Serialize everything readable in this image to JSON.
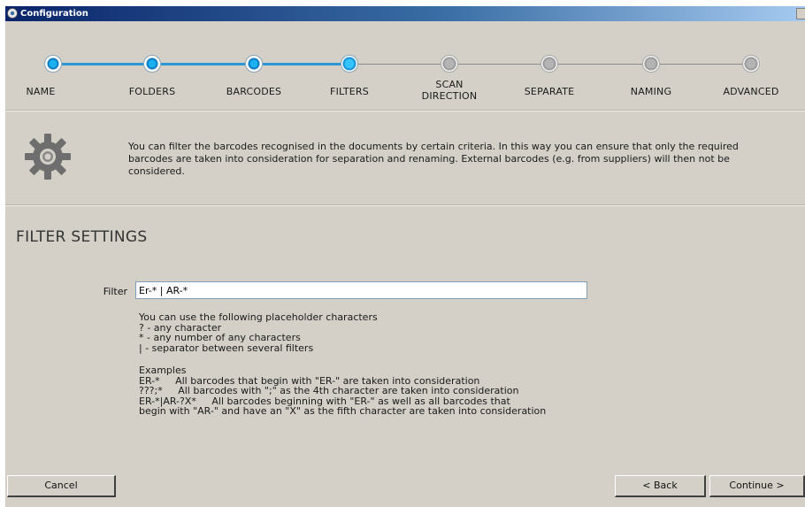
{
  "window": {
    "title": "Configuration"
  },
  "steps": [
    {
      "label": "NAME",
      "state": "done"
    },
    {
      "label": "FOLDERS",
      "state": "done"
    },
    {
      "label": "BARCODES",
      "state": "done"
    },
    {
      "label": "FILTERS",
      "state": "current"
    },
    {
      "label": "SCAN\nDIRECTION",
      "state": "pending"
    },
    {
      "label": "SEPARATE",
      "state": "pending"
    },
    {
      "label": "NAMING",
      "state": "pending"
    },
    {
      "label": "ADVANCED",
      "state": "pending"
    }
  ],
  "info": {
    "text": "You can filter the barcodes recognised in the documents by certain criteria. In this way you can ensure that only the required\nbarcodes are taken into consideration for separation and renaming. External barcodes (e.g. from suppliers) will then not be\nconsidered."
  },
  "section": {
    "title": "FILTER SETTINGS"
  },
  "filter": {
    "label": "Filter",
    "value": "Er-* | AR-*"
  },
  "help": {
    "intro": "You can use the following placeholder characters",
    "placeholders": [
      "? - any character",
      "* - any number of any characters",
      "| - separator between several filters"
    ],
    "examples_title": "Examples",
    "examples": [
      "ER-*     All barcodes that begin with \"ER-\" are taken into consideration",
      "???;*     All barcodes with \";\" as the 4th character are taken into consideration",
      "ER-*|AR-?X*     All barcodes beginning with \"ER-\" as well as all barcodes that",
      "begin with \"AR-\" and have an \"X\" as the fifth character are taken into consideration"
    ]
  },
  "buttons": {
    "cancel": "Cancel",
    "back": "< Back",
    "continue": "Continue >"
  },
  "colors": {
    "accent": "#2e97d6",
    "titlebar": "#0a246a",
    "dialog": "#d4d0c8"
  }
}
